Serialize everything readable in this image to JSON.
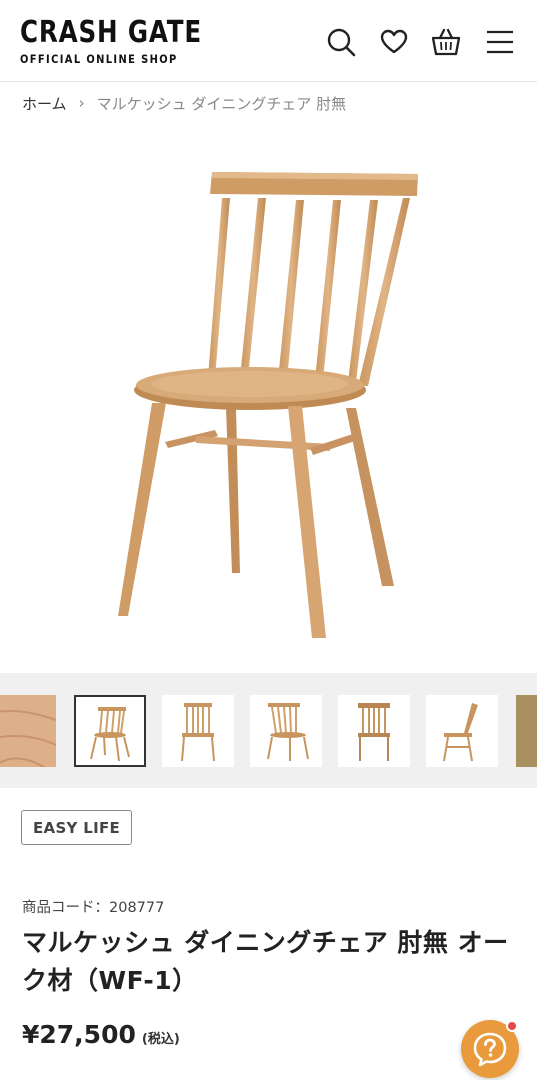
{
  "header": {
    "logo_main": "CRASH GATE",
    "logo_sub": "OFFICIAL ONLINE SHOP",
    "icons": [
      "search-icon",
      "heart-icon",
      "basket-icon",
      "menu-icon"
    ]
  },
  "breadcrumb": {
    "home": "ホーム",
    "separator": "›",
    "current": "マルケッシュ ダイニングチェア 肘無"
  },
  "gallery": {
    "main_image": "chair-front-angle",
    "thumbnails": [
      {
        "name": "wood-texture",
        "active": false
      },
      {
        "name": "chair-angle",
        "active": true
      },
      {
        "name": "chair-front",
        "active": false
      },
      {
        "name": "chair-side-angle",
        "active": false
      },
      {
        "name": "chair-back",
        "active": false
      },
      {
        "name": "chair-side",
        "active": false
      },
      {
        "name": "wood-detail",
        "active": false
      }
    ]
  },
  "product": {
    "brand": "EASY LIFE",
    "code_label": "商品コード：208777",
    "title": "マルケッシュ ダイニングチェア 肘無 オーク材（WF-1）",
    "price": "¥27,500",
    "tax_note": "(税込)"
  },
  "colors": {
    "wood": "#d3a270",
    "wood_dark": "#b98552",
    "help_button": "#e89a3c",
    "notification": "#e84747"
  }
}
